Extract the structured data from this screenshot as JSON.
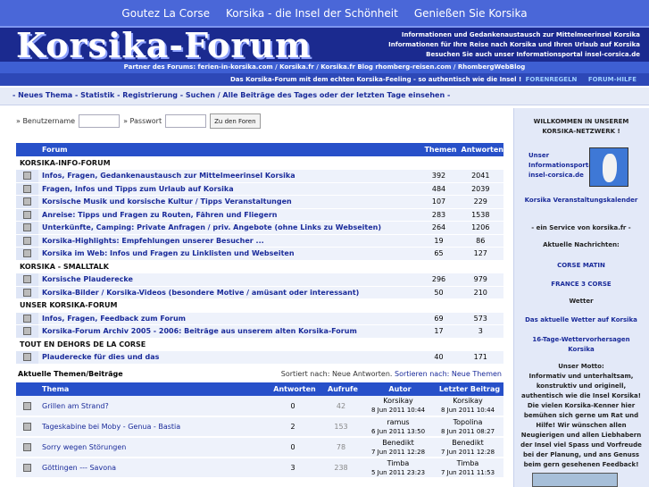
{
  "topnav": [
    "Goutez La Corse",
    "Korsika - die Insel der Schönheit",
    "Genießen Sie Korsika"
  ],
  "logo": "Korsika-Forum",
  "tagline": [
    "Informationen und Gedankenaustausch zur Mittelmeerinsel Korsika",
    "Informationen für Ihre Reise nach Korsika und Ihren Urlaub auf Korsika",
    "Besuchen Sie auch unser Informationsportal insel-corsica.de"
  ],
  "partners": "Partner des Forums:  ferien-in-korsika.com / Korsika.fr / Korsika.fr Blog     rhomberg-reisen.com / RhombergWebBlog",
  "slogan": "Das Korsika-Forum mit dem echten Korsika-Feeling - so authentisch wie die Insel !",
  "slogan_links": [
    "FORENREGELN",
    "FORUM-HILFE"
  ],
  "breadcrumb": "- Neues Thema - Statistik - Registrierung - Suchen / Alle Beiträge des Tages oder der letzten Tage einsehen -",
  "login": {
    "user_label": "» Benutzername",
    "pass_label": "» Passwort",
    "button": "Zu den Foren"
  },
  "forum_table": {
    "headers": [
      "Forum",
      "Themen",
      "Antworten"
    ],
    "rows": [
      {
        "cat": "KORSIKA-INFO-FORUM"
      },
      {
        "name": "Infos, Fragen, Gedankenaustausch zur Mittelmeerinsel Korsika",
        "themen": "392",
        "antworten": "2041"
      },
      {
        "name": "Fragen, Infos und Tipps zum Urlaub auf Korsika",
        "themen": "484",
        "antworten": "2039"
      },
      {
        "name": "Korsische Musik und korsische Kultur / Tipps Veranstaltungen",
        "themen": "107",
        "antworten": "229"
      },
      {
        "name": "Anreise: Tipps und Fragen zu Routen, Fähren und Fliegern",
        "themen": "283",
        "antworten": "1538"
      },
      {
        "name": "Unterkünfte, Camping: Private Anfragen / priv. Angebote (ohne Links zu Webseiten)",
        "themen": "264",
        "antworten": "1206"
      },
      {
        "name": "Korsika-Highlights: Empfehlungen unserer Besucher ...",
        "themen": "19",
        "antworten": "86"
      },
      {
        "name": "Korsika im Web: Infos und Fragen zu Linklisten und Webseiten",
        "themen": "65",
        "antworten": "127"
      },
      {
        "cat": "KORSIKA - SMALLTALK"
      },
      {
        "name": "Korsische Plauderecke",
        "themen": "296",
        "antworten": "979"
      },
      {
        "name": "Korsika-Bilder / Korsika-Videos (besondere Motive / amüsant oder interessant)",
        "themen": "50",
        "antworten": "210"
      },
      {
        "cat": "UNSER KORSIKA-FORUM"
      },
      {
        "name": "Infos, Fragen, Feedback zum Forum",
        "themen": "69",
        "antworten": "573"
      },
      {
        "name": "Korsika-Forum Archiv 2005 - 2006: Beiträge aus unserem alten Korsika-Forum",
        "themen": "17",
        "antworten": "3"
      },
      {
        "cat": "TOUT EN DEHORS DE LA CORSE"
      },
      {
        "name": "Plauderecke für dies und das",
        "themen": "40",
        "antworten": "171"
      }
    ]
  },
  "topics": {
    "title": "Aktuelle Themen/Beiträge",
    "sort_label": "Sortiert nach: Neue Antworten.",
    "sort_link": "Sortieren nach: Neue Themen",
    "headers": [
      "Thema",
      "Antworten",
      "Aufrufe",
      "Autor",
      "Letzter Beitrag"
    ],
    "rows": [
      {
        "thema": "Grillen am Strand?",
        "antworten": "0",
        "aufrufe": "42",
        "autor": "Korsikay",
        "autor_date": "8 Jun 2011 10:44",
        "letzter": "Korsikay",
        "letzter_date": "8 Jun 2011 10:44"
      },
      {
        "thema": "Tageskabine bei Moby - Genua - Bastia",
        "antworten": "2",
        "aufrufe": "153",
        "autor": "ramus",
        "autor_date": "6 Jun 2011 13:50",
        "letzter": "Topolina",
        "letzter_date": "8 Jun 2011 08:27"
      },
      {
        "thema": "Sorry wegen Störungen",
        "antworten": "0",
        "aufrufe": "78",
        "autor": "Benedikt",
        "autor_date": "7 Jun 2011 12:28",
        "letzter": "Benedikt",
        "letzter_date": "7 Jun 2011 12:28"
      },
      {
        "thema": "Göttingen --- Savona",
        "antworten": "3",
        "aufrufe": "238",
        "autor": "Timba",
        "autor_date": "5 Jun 2011 23:23",
        "letzter": "Timba",
        "letzter_date": "7 Jun 2011 11:53"
      }
    ]
  },
  "sidebar": {
    "welcome": "WILLKOMMEN IN UNSEREM KORSIKA-NETZWERK !",
    "portal": "Unser Informationsportal insel-corsica.de",
    "kalender": "Korsika Veranstaltungskalender",
    "service": "- ein Service von korsika.fr -",
    "news_title": "Aktuelle Nachrichten:",
    "news": [
      "CORSE MATIN",
      "FRANCE 3 CORSE"
    ],
    "weather_title": "Wetter",
    "weather": [
      "Das aktuelle Wetter auf Korsika",
      "16-Tage-Wettervorhersagen Korsika"
    ],
    "motto_title": "Unser Motto:",
    "motto": "Informativ und unterhaltsam, konstruktiv und originell, authentisch wie die Insel Korsika! Die vielen Korsika-Kenner hier bemühen sich gerne um Rat und Hilfe! Wir wünschen allen Neugierigen und allen Liebhabern der Insel viel Spass und Vorfreude bei der Planung, und ans Genuss beim gern gesehenen Feedback!"
  }
}
